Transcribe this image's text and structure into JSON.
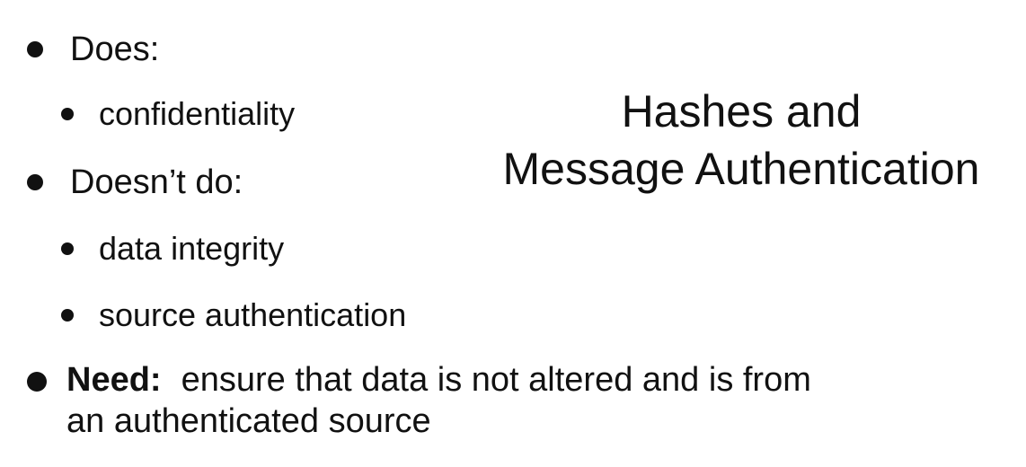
{
  "slide": {
    "title_line1": "Hashes and",
    "title_line2": "Message Authentication",
    "bullets": {
      "does": "Does:",
      "confidentiality": "confidentiality",
      "doesnt_do": "Doesn’t do:",
      "data_integrity": "data integrity",
      "source_auth": "source authentication",
      "need_label": "Need:",
      "need_line1": "ensure that data is not altered and is from",
      "need_line2": "an authenticated source"
    }
  }
}
